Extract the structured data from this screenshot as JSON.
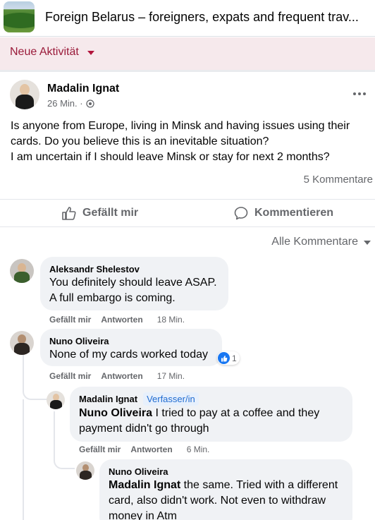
{
  "header": {
    "group_title": "Foreign Belarus – foreigners, expats and frequent trav..."
  },
  "filter": {
    "label": "Neue Aktivität"
  },
  "post": {
    "author": "Madalin Ignat",
    "time": "26 Min. ·",
    "privacy_icon": "globe-icon",
    "text_lines": [
      "Is anyone from Europe, living in Minsk and having issues using their cards. Do you believe this is an inevitable situation?",
      "I am uncertain if I should leave Minsk or stay for next 2 months?"
    ],
    "comment_count": "5 Kommentare",
    "like_label": "Gefällt mir",
    "comment_label": "Kommentieren",
    "sort_label": "Alle Kommentare"
  },
  "comments": [
    {
      "name": "Aleksandr Shelestov",
      "text_line1": "You definitely should leave ASAP.",
      "text_line2": "A full embargo is coming.",
      "like": "Gefällt mir",
      "reply": "Antworten",
      "time": "18 Min."
    },
    {
      "name": "Nuno Oliveira",
      "text": "None of my cards worked today",
      "reaction_count": "1",
      "like": "Gefällt mir",
      "reply": "Antworten",
      "time": "17 Min."
    },
    {
      "name": "Madalin Ignat",
      "badge": "Verfasser/in",
      "mention": "Nuno Oliveira",
      "text_rest": " I tried to pay at a coffee and they payment didn't go through",
      "like": "Gefällt mir",
      "reply": "Antworten",
      "time": "6 Min."
    },
    {
      "name": "Nuno Oliveira",
      "mention": "Madalin Ignat",
      "text_rest": " the same. Tried with a different card, also didn't work. Not even to withdraw money in Atm"
    }
  ],
  "colors": {
    "accent": "#9a1b3a",
    "filter_bg": "#f6e9ec",
    "bubble_bg": "#f0f2f5",
    "facebook_blue": "#1877f2"
  }
}
